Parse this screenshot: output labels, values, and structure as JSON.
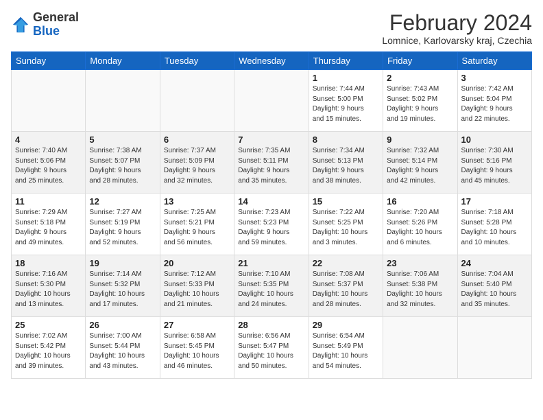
{
  "header": {
    "logo_general": "General",
    "logo_blue": "Blue",
    "month_year": "February 2024",
    "location": "Lomnice, Karlovarsky kraj, Czechia"
  },
  "weekdays": [
    "Sunday",
    "Monday",
    "Tuesday",
    "Wednesday",
    "Thursday",
    "Friday",
    "Saturday"
  ],
  "weeks": [
    [
      {
        "day": "",
        "info": ""
      },
      {
        "day": "",
        "info": ""
      },
      {
        "day": "",
        "info": ""
      },
      {
        "day": "",
        "info": ""
      },
      {
        "day": "1",
        "info": "Sunrise: 7:44 AM\nSunset: 5:00 PM\nDaylight: 9 hours\nand 15 minutes."
      },
      {
        "day": "2",
        "info": "Sunrise: 7:43 AM\nSunset: 5:02 PM\nDaylight: 9 hours\nand 19 minutes."
      },
      {
        "day": "3",
        "info": "Sunrise: 7:42 AM\nSunset: 5:04 PM\nDaylight: 9 hours\nand 22 minutes."
      }
    ],
    [
      {
        "day": "4",
        "info": "Sunrise: 7:40 AM\nSunset: 5:06 PM\nDaylight: 9 hours\nand 25 minutes."
      },
      {
        "day": "5",
        "info": "Sunrise: 7:38 AM\nSunset: 5:07 PM\nDaylight: 9 hours\nand 28 minutes."
      },
      {
        "day": "6",
        "info": "Sunrise: 7:37 AM\nSunset: 5:09 PM\nDaylight: 9 hours\nand 32 minutes."
      },
      {
        "day": "7",
        "info": "Sunrise: 7:35 AM\nSunset: 5:11 PM\nDaylight: 9 hours\nand 35 minutes."
      },
      {
        "day": "8",
        "info": "Sunrise: 7:34 AM\nSunset: 5:13 PM\nDaylight: 9 hours\nand 38 minutes."
      },
      {
        "day": "9",
        "info": "Sunrise: 7:32 AM\nSunset: 5:14 PM\nDaylight: 9 hours\nand 42 minutes."
      },
      {
        "day": "10",
        "info": "Sunrise: 7:30 AM\nSunset: 5:16 PM\nDaylight: 9 hours\nand 45 minutes."
      }
    ],
    [
      {
        "day": "11",
        "info": "Sunrise: 7:29 AM\nSunset: 5:18 PM\nDaylight: 9 hours\nand 49 minutes."
      },
      {
        "day": "12",
        "info": "Sunrise: 7:27 AM\nSunset: 5:19 PM\nDaylight: 9 hours\nand 52 minutes."
      },
      {
        "day": "13",
        "info": "Sunrise: 7:25 AM\nSunset: 5:21 PM\nDaylight: 9 hours\nand 56 minutes."
      },
      {
        "day": "14",
        "info": "Sunrise: 7:23 AM\nSunset: 5:23 PM\nDaylight: 9 hours\nand 59 minutes."
      },
      {
        "day": "15",
        "info": "Sunrise: 7:22 AM\nSunset: 5:25 PM\nDaylight: 10 hours\nand 3 minutes."
      },
      {
        "day": "16",
        "info": "Sunrise: 7:20 AM\nSunset: 5:26 PM\nDaylight: 10 hours\nand 6 minutes."
      },
      {
        "day": "17",
        "info": "Sunrise: 7:18 AM\nSunset: 5:28 PM\nDaylight: 10 hours\nand 10 minutes."
      }
    ],
    [
      {
        "day": "18",
        "info": "Sunrise: 7:16 AM\nSunset: 5:30 PM\nDaylight: 10 hours\nand 13 minutes."
      },
      {
        "day": "19",
        "info": "Sunrise: 7:14 AM\nSunset: 5:32 PM\nDaylight: 10 hours\nand 17 minutes."
      },
      {
        "day": "20",
        "info": "Sunrise: 7:12 AM\nSunset: 5:33 PM\nDaylight: 10 hours\nand 21 minutes."
      },
      {
        "day": "21",
        "info": "Sunrise: 7:10 AM\nSunset: 5:35 PM\nDaylight: 10 hours\nand 24 minutes."
      },
      {
        "day": "22",
        "info": "Sunrise: 7:08 AM\nSunset: 5:37 PM\nDaylight: 10 hours\nand 28 minutes."
      },
      {
        "day": "23",
        "info": "Sunrise: 7:06 AM\nSunset: 5:38 PM\nDaylight: 10 hours\nand 32 minutes."
      },
      {
        "day": "24",
        "info": "Sunrise: 7:04 AM\nSunset: 5:40 PM\nDaylight: 10 hours\nand 35 minutes."
      }
    ],
    [
      {
        "day": "25",
        "info": "Sunrise: 7:02 AM\nSunset: 5:42 PM\nDaylight: 10 hours\nand 39 minutes."
      },
      {
        "day": "26",
        "info": "Sunrise: 7:00 AM\nSunset: 5:44 PM\nDaylight: 10 hours\nand 43 minutes."
      },
      {
        "day": "27",
        "info": "Sunrise: 6:58 AM\nSunset: 5:45 PM\nDaylight: 10 hours\nand 46 minutes."
      },
      {
        "day": "28",
        "info": "Sunrise: 6:56 AM\nSunset: 5:47 PM\nDaylight: 10 hours\nand 50 minutes."
      },
      {
        "day": "29",
        "info": "Sunrise: 6:54 AM\nSunset: 5:49 PM\nDaylight: 10 hours\nand 54 minutes."
      },
      {
        "day": "",
        "info": ""
      },
      {
        "day": "",
        "info": ""
      }
    ]
  ],
  "shaded_rows": [
    1,
    3
  ]
}
